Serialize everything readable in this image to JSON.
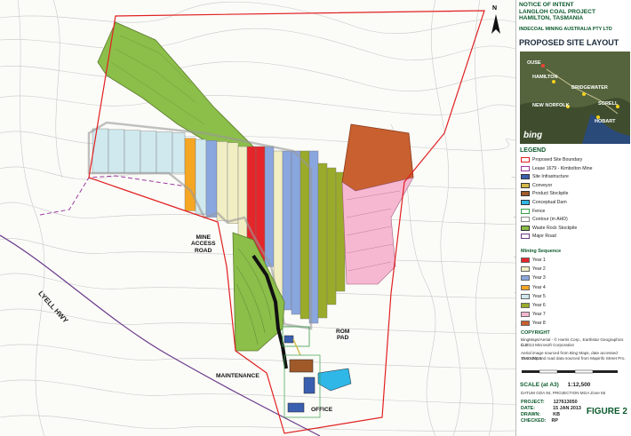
{
  "header": {
    "line1": "NOTICE OF INTENT",
    "line2": "LANGLOH COAL PROJECT",
    "line3": "HAMILTON, TASMANIA",
    "company": "INDECOAL MINING AUSTRALIA PTY LTD",
    "title": "PROPOSED SITE LAYOUT"
  },
  "inset": {
    "labels": [
      "OUSE",
      "HAMILTON",
      "BRIDGEWATER",
      "NEW NORFOLK",
      "SORELL",
      "HOBART"
    ],
    "provider": "bing"
  },
  "legend": {
    "heading": "LEGEND",
    "items": [
      {
        "label": "Proposed Site Boundary",
        "color": "#ffffff",
        "border": "#e02020"
      },
      {
        "label": "Lease 1679 - Kimbolton Mine",
        "color": "#ffffff",
        "border": "#9c3aa0"
      },
      {
        "label": "Site Infrastructure",
        "color": "#3b5fb0",
        "border": "#333"
      },
      {
        "label": "Conveyor",
        "color": "#d4b84a",
        "border": "#333"
      },
      {
        "label": "Product Stockpile",
        "color": "#a05a2a",
        "border": "#333"
      },
      {
        "label": "Conceptual Dam",
        "color": "#2fb7e8",
        "border": "#333"
      },
      {
        "label": "Fence",
        "color": "#ffffff",
        "border": "#3aa04a"
      },
      {
        "label": "Contour (m AHD)",
        "color": "#ffffff",
        "border": "#888"
      },
      {
        "label": "Waste Rock Stockpile",
        "color": "#8cbe4a",
        "border": "#333"
      },
      {
        "label": "Major Road",
        "color": "#ffffff",
        "border": "#6a3a8a"
      }
    ],
    "sequence_heading": "Mining Sequence",
    "sequence": [
      {
        "label": "Year 1",
        "color": "#e4262a"
      },
      {
        "label": "Year 2",
        "color": "#f1eec4"
      },
      {
        "label": "Year 3",
        "color": "#8aa6de"
      },
      {
        "label": "Year 4",
        "color": "#f5a623"
      },
      {
        "label": "Year 5",
        "color": "#cfe9ee"
      },
      {
        "label": "Year 6",
        "color": "#9aaa2a"
      },
      {
        "label": "Year 7",
        "color": "#f6b7d1"
      },
      {
        "label": "Year 8",
        "color": "#c8602f"
      }
    ]
  },
  "copyright": {
    "heading": "COPYRIGHT",
    "line1": "BingMaps/Aerial - © Harris Corp., Earthstar Geographics LLC",
    "line2": "© 2013 Microsoft Corporation",
    "line3": "Aerial image sourced from Bing Maps, date accessed 15.01.2013.",
    "line4": "Township and road data sourced from Mapinfo Street Pro."
  },
  "scale": {
    "label": "SCALE (at A3)",
    "ratio": "1:12,500",
    "datum": "DATUM GDA 94, PROJECTION MGA Zone 55"
  },
  "project": {
    "project_label": "PROJECT:",
    "project_value": "127613050",
    "date_label": "DATE:",
    "date_value": "15 JAN 2013",
    "drawn_label": "DRAWN:",
    "drawn_value": "KB",
    "checked_label": "CHECKED:",
    "checked_value": "RP"
  },
  "figure": "FIGURE 2",
  "map_labels": {
    "mine_access_road": "MINE\nACCESS\nROAD",
    "rom_pad": "ROM\nPAD",
    "maintenance": "MAINTENANCE",
    "office": "OFFICE",
    "lyell_hwy": "LYELL HWY",
    "north": "N"
  }
}
